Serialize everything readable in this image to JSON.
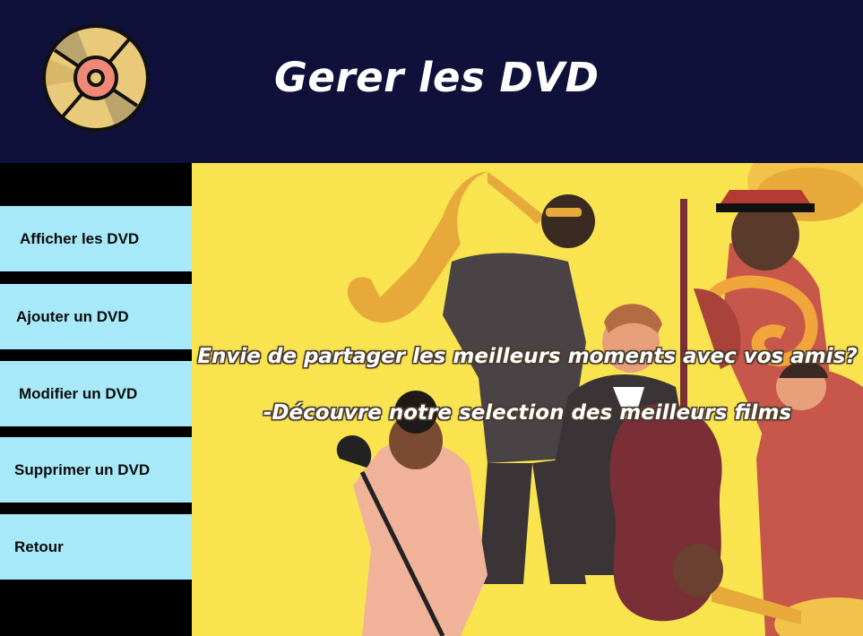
{
  "header": {
    "title": "Gerer les DVD",
    "logo_icon": "dvd-disc-icon"
  },
  "sidebar": {
    "items": [
      {
        "label": "Afficher les DVD"
      },
      {
        "label": "Ajouter un DVD"
      },
      {
        "label": "Modifier un DVD"
      },
      {
        "label": "Supprimer un DVD"
      },
      {
        "label": "Retour"
      }
    ]
  },
  "main": {
    "tagline_1": "Envie de partager les meilleurs moments avec vos amis?",
    "tagline_2": "-Découvre notre selection des meilleurs films",
    "illustration": "jazz-band-illustration"
  },
  "colors": {
    "header_bg": "#10113a",
    "sidebar_bg": "#000000",
    "button_bg": "#a7e9f8",
    "main_bg": "#f9e44f"
  }
}
